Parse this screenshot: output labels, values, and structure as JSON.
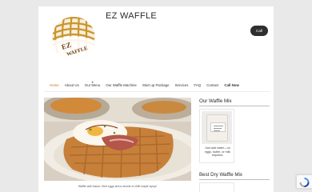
{
  "site": {
    "title": "EZ WAFFLE",
    "logo_text_top": "EZ",
    "logo_text_bottom": "WAFFLE"
  },
  "header": {
    "call_label": "Call"
  },
  "nav": {
    "items": [
      {
        "label": "Home",
        "active": true
      },
      {
        "label": "About Us"
      },
      {
        "label": "Our Menu",
        "has_submenu": true
      },
      {
        "label": "Our Waffle Machine"
      },
      {
        "label": "Start up Package"
      },
      {
        "label": "Services"
      },
      {
        "label": "FAQ"
      },
      {
        "label": "Contact"
      },
      {
        "label": "Call Now",
        "bold": true
      }
    ]
  },
  "hero": {
    "caption": "Waffle with bacon, fried eggs and a drizzle of chilli maple syrup!"
  },
  "sidebar": {
    "mix_heading": "Our Waffle Mix",
    "mix_description": "Just add water—no eggs, butter, or milk required.",
    "dry_mix_heading": "Best Dry Waffle Mix"
  },
  "colors": {
    "accent": "#c07a1e",
    "logo_gold": "#c9962a",
    "logo_brown": "#6a3f14",
    "page_bg": "#e9e9e9",
    "call_btn_bg": "#2f2f2f"
  }
}
